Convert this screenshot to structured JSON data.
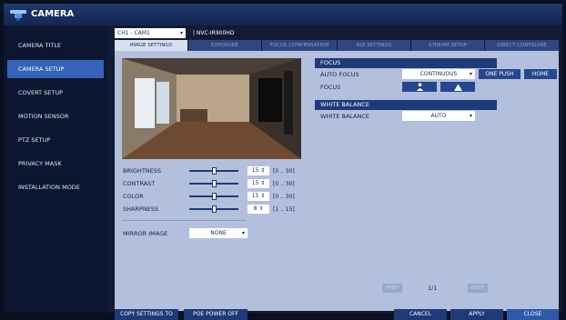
{
  "app": {
    "title": "CAMERA"
  },
  "sidebar": {
    "items": [
      {
        "label": "CAMERA TITLE"
      },
      {
        "label": "CAMERA SETUP",
        "active": true
      },
      {
        "label": "COVERT SETUP"
      },
      {
        "label": "MOTION SENSOR"
      },
      {
        "label": "PTZ SETUP"
      },
      {
        "label": "PRIVACY MASK"
      },
      {
        "label": "INSTALLATION MODE"
      }
    ]
  },
  "channel": {
    "selected": "CH1 - CAM1",
    "model": "|  NVC-IR900HD"
  },
  "tabs": [
    {
      "label": "IMAGE SETTINGS",
      "active": true
    },
    {
      "label": "EXPOSURE"
    },
    {
      "label": "FOCUS COMPENSATION"
    },
    {
      "label": "ROI SETTINGS"
    },
    {
      "label": "STREAM SETUP"
    },
    {
      "label": "DIRECT CONFIGURE"
    }
  ],
  "adjustments": [
    {
      "label": "BRIGHTNESS",
      "value": "15",
      "range": "[0 .. 30]",
      "fraction": 0.5
    },
    {
      "label": "CONTRAST",
      "value": "15",
      "range": "[0 .. 30]",
      "fraction": 0.5
    },
    {
      "label": "COLOR",
      "value": "15",
      "range": "[0 .. 30]",
      "fraction": 0.5
    },
    {
      "label": "SHARPNESS",
      "value": "8",
      "range": "[1 .. 15]",
      "fraction": 0.5
    }
  ],
  "mirror": {
    "label": "MIRROR IMAGE",
    "value": "NONE"
  },
  "focus": {
    "section": "FOCUS",
    "auto_focus_label": "AUTO FOCUS",
    "auto_focus_value": "CONTINUOUS",
    "one_push": "ONE PUSH",
    "home": "HOME",
    "focus_label": "FOCUS"
  },
  "white_balance": {
    "section": "WHITE BALANCE",
    "label": "WHITE BALANCE",
    "value": "AUTO"
  },
  "pager": {
    "prev": "PREV",
    "page": "1/1",
    "next": "NEXT"
  },
  "footer": {
    "copy_settings": "COPY SETTINGS TO",
    "poe_power_off": "POE POWER OFF",
    "cancel": "CANCEL",
    "apply": "APPLY",
    "close": "CLOSE"
  },
  "colors": {
    "accent": "#3463b8",
    "panel": "#b3c0dd",
    "header": "#1e3a78"
  },
  "icons": {
    "camera": "camera-icon",
    "person": "person-icon",
    "mountain": "mountain-icon"
  }
}
